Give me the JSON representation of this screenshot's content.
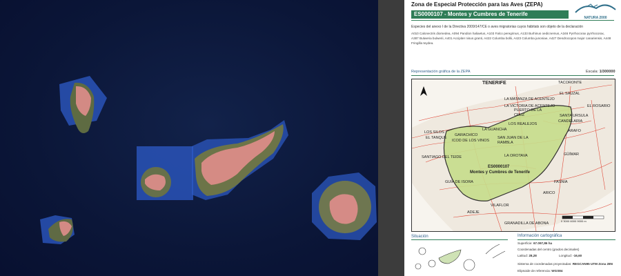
{
  "document": {
    "title": "Zona de Especial Protección para las Aves (ZEPA)",
    "site_code_title": "ES0000107 - Montes y Cumbres de Tenerife",
    "logo_text": "NATURA 2000",
    "species_heading": "Especies del anexo I de la Directiva 2009/147/CE o aves migratorias cuyos hábitats son objeto de la declaración",
    "species_text": "A010 Calonectris diomedea, A094 Pandion haliaetus, A103 Falco peregrinus, A133 Burhinus oedicnemus, A346 Pyrrhocorax pyrrhocorax, A387 Bulweria bulwerii, A401 Accipiter nisus granti, A422 Columba bollii, A423 Columba junoniae, A427 Dendrocopos major canariensis, A448 Fringilla teydea.",
    "representation_label": "Representación gráfica de la ZEPA",
    "scale_prefix": "Escala:",
    "scale_value": "1/300000",
    "situation_label": "Situación",
    "carto_label": "Información cartográfica",
    "surface_label": "Superficie:",
    "surface_value": "67.097,86 ha",
    "centre_coords_label": "Coordenadas del centro (grados decimales)",
    "lat_label": "Latitud:",
    "lat_value": "28,28",
    "lon_label": "Longitud:",
    "lon_value": "-16,60",
    "projection_label": "Sistema de coordenadas proyectadas:",
    "projection_value": "REGCAN95 UTM Zona 28N",
    "ellipsoid_label": "Elipsoide de referencia:",
    "ellipsoid_value": "WGS84"
  },
  "map": {
    "island_label": "TENERIFE",
    "site_label_code": "ES0000107",
    "site_label_name": "Montes y Cumbres de Tenerife",
    "scalebar_text": "0    3000    6000    9000 m",
    "places": [
      {
        "name": "TACORONTE"
      },
      {
        "name": "EL SAUZAL"
      },
      {
        "name": "LA MATANZA DE ACENTEJO"
      },
      {
        "name": "LA VICTORIA DE ACENTEJO"
      },
      {
        "name": "PUERTO DE LA CRUZ"
      },
      {
        "name": "EL ROSARIO"
      },
      {
        "name": "SANTA URSULA"
      },
      {
        "name": "CANDELARIA"
      },
      {
        "name": "LOS REALEJOS"
      },
      {
        "name": "LA GUANCHA"
      },
      {
        "name": "LOS SILOS"
      },
      {
        "name": "EL TANQUE"
      },
      {
        "name": "GARACHICO"
      },
      {
        "name": "ICOD DE LOS VINOS"
      },
      {
        "name": "SAN JUAN DE LA RAMBLA"
      },
      {
        "name": "ARAFO"
      },
      {
        "name": "GÜÍMAR"
      },
      {
        "name": "SANTIAGO DEL TEIDE"
      },
      {
        "name": "LA OROTAVA"
      },
      {
        "name": "FASNIA"
      },
      {
        "name": "GUÍA DE ISORA"
      },
      {
        "name": "ARICO"
      },
      {
        "name": "ADEJE"
      },
      {
        "name": "VILAFLOR"
      },
      {
        "name": "GRANADILLA DE ABONA"
      }
    ]
  },
  "colors": {
    "ocean": "#0b1638",
    "zepa_fill": "#e88f8f",
    "buffer_blue": "#2e5bc8",
    "doc_green": "#2f7d57",
    "road_red": "#e04a3a"
  }
}
